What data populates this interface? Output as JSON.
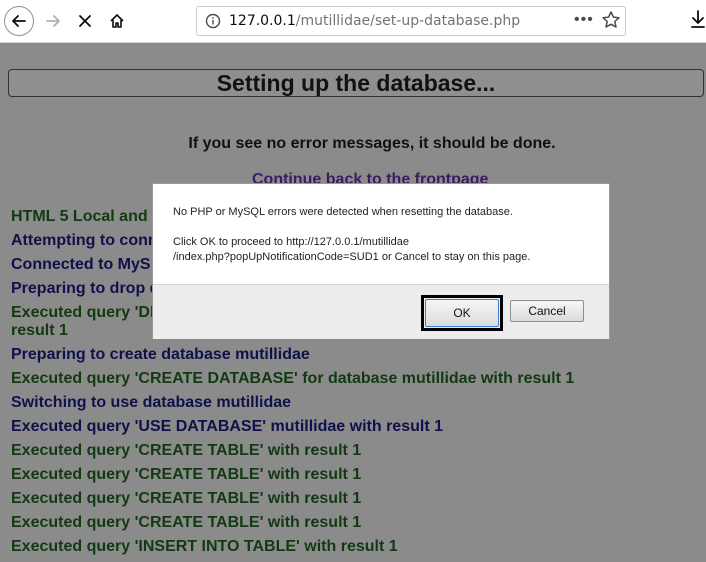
{
  "browser": {
    "url_host": "127.0.0.1",
    "url_path": "/mutillidae/set-up-database.php",
    "more_icon": "•••"
  },
  "page": {
    "title": "Setting up the database...",
    "notice": "If you see no error messages, it should be done.",
    "frontpage_link": "Continue back to the frontpage",
    "log": [
      {
        "text": "HTML 5 Local and",
        "status": "ok"
      },
      {
        "text": "Attempting to conn",
        "status": "info"
      },
      {
        "text": "Connected to MyS",
        "status": "info"
      },
      {
        "text": "Preparing to drop d",
        "status": "info"
      },
      {
        "text": "Executed query 'DI",
        "status": "ok"
      },
      {
        "text": "result 1",
        "status": "ok"
      },
      {
        "text": "Preparing to create database mutillidae",
        "status": "info"
      },
      {
        "text": "Executed query 'CREATE DATABASE' for database mutillidae with result 1",
        "status": "ok"
      },
      {
        "text": "Switching to use database mutillidae",
        "status": "info"
      },
      {
        "text": "Executed query 'USE DATABASE' mutillidae with result 1",
        "status": "info"
      },
      {
        "text": "Executed query 'CREATE TABLE' with result 1",
        "status": "ok"
      },
      {
        "text": "Executed query 'CREATE TABLE' with result 1",
        "status": "ok"
      },
      {
        "text": "Executed query 'CREATE TABLE' with result 1",
        "status": "ok"
      },
      {
        "text": "Executed query 'CREATE TABLE' with result 1",
        "status": "ok"
      },
      {
        "text": "Executed query 'INSERT INTO TABLE' with result 1",
        "status": "ok"
      }
    ]
  },
  "dialog": {
    "message": [
      "No PHP or MySQL errors were detected when resetting the database.",
      "Click OK to proceed to http://127.0.0.1/mutillidae",
      "/index.php?popUpNotificationCode=SUD1 or Cancel to stay on this page."
    ],
    "ok_label": "OK",
    "cancel_label": "Cancel"
  },
  "colors": {
    "overlay_bg": "#8b8b8b",
    "log_ok": "#123a12",
    "log_info": "#10104a",
    "link": "#3b1b62"
  }
}
